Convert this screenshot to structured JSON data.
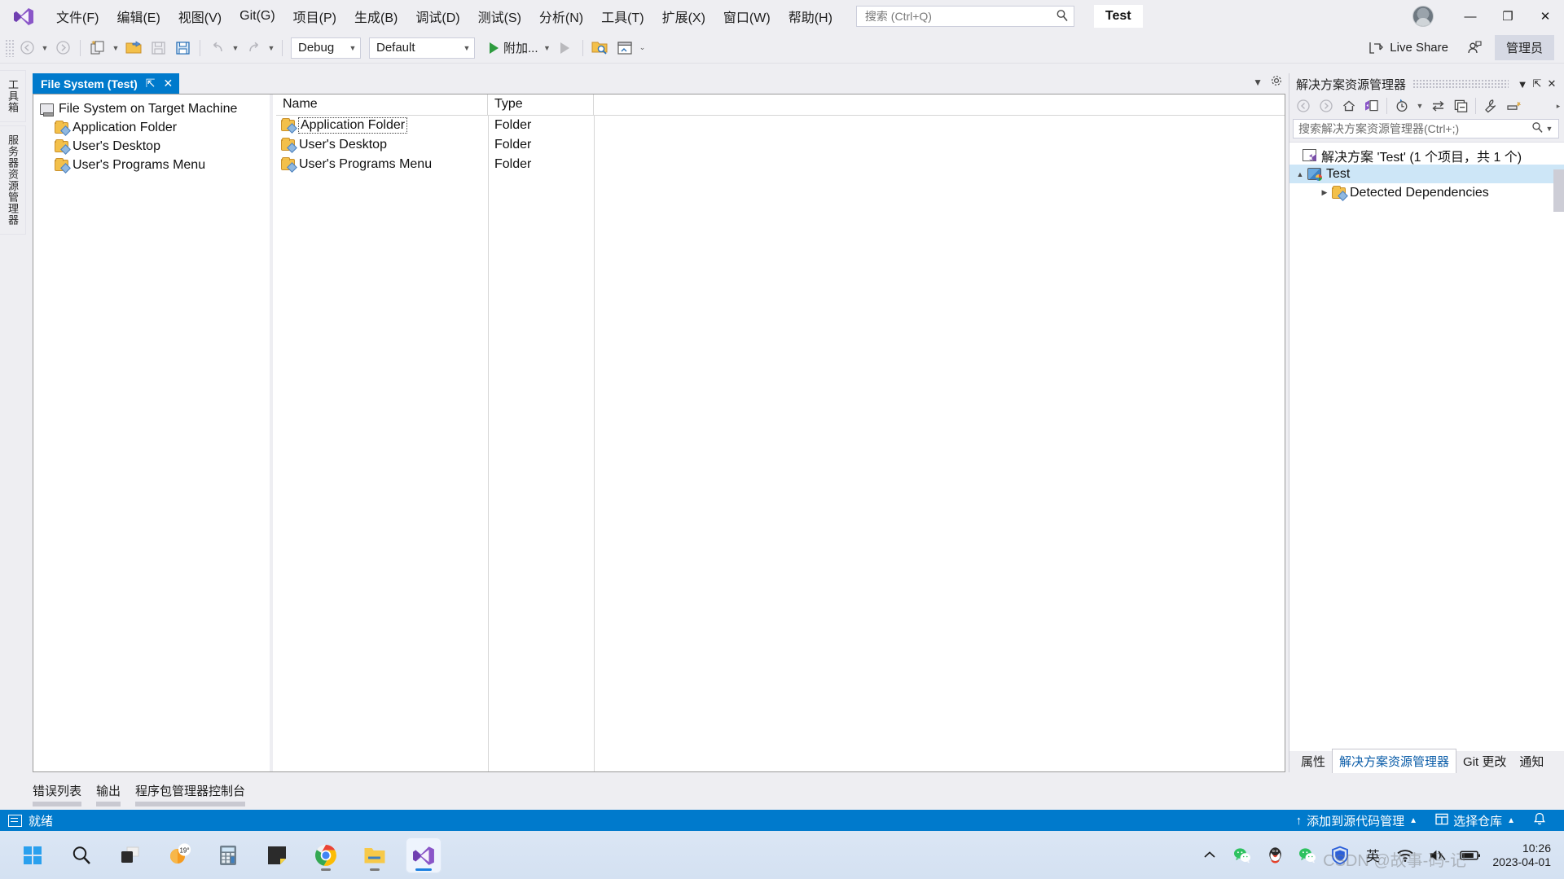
{
  "app": {
    "logo_icon": "visual-studio-logo",
    "solution_badge": "Test",
    "quick_search_placeholder": "搜索 (Ctrl+Q)",
    "search_icon": "search-icon"
  },
  "menu": {
    "items": [
      {
        "label": "文件(F)"
      },
      {
        "label": "编辑(E)"
      },
      {
        "label": "视图(V)"
      },
      {
        "label": "Git(G)"
      },
      {
        "label": "项目(P)"
      },
      {
        "label": "生成(B)"
      },
      {
        "label": "调试(D)"
      },
      {
        "label": "测试(S)"
      },
      {
        "label": "分析(N)"
      },
      {
        "label": "工具(T)"
      },
      {
        "label": "扩展(X)"
      },
      {
        "label": "窗口(W)"
      },
      {
        "label": "帮助(H)"
      }
    ]
  },
  "window_controls": {
    "minimize": "—",
    "maximize": "❐",
    "close": "✕",
    "avatar_icon": "user-avatar"
  },
  "toolbar": {
    "back_icon": "back-arrow-icon",
    "forward_icon": "forward-arrow-icon",
    "new_project_icon": "new-project-icon",
    "open_icon": "open-file-icon",
    "save_icon": "save-icon",
    "save_all_icon": "save-all-icon",
    "undo_icon": "undo-icon",
    "redo_icon": "redo-icon",
    "configuration": "Debug",
    "platform": "Default",
    "run_label": "附加...",
    "run_icon": "play-icon",
    "step_icon": "start-without-debug-icon",
    "find_in_files_icon": "find-in-files-icon",
    "window_layout_icon": "window-layout-icon",
    "overflow_icon": "toolbar-overflow-icon",
    "live_share_label": "Live Share",
    "live_share_icon": "live-share-icon",
    "feedback_icon": "feedback-icon",
    "admin_label": "管理员"
  },
  "left_vertical_tabs": [
    {
      "label": "工具箱"
    },
    {
      "label": "服务器资源管理器"
    }
  ],
  "document": {
    "tab_label": "File System (Test)",
    "pin_icon": "pin-icon",
    "close_icon": "close-icon",
    "dropdown_icon": "chevron-down-icon",
    "settings_icon": "gear-icon"
  },
  "file_system_tree": {
    "root": {
      "label": "File System on Target Machine",
      "icon": "target-machine-icon"
    },
    "children": [
      {
        "label": "Application Folder",
        "icon": "folder-icon"
      },
      {
        "label": "User's Desktop",
        "icon": "folder-icon"
      },
      {
        "label": "User's Programs Menu",
        "icon": "folder-icon"
      }
    ]
  },
  "file_list": {
    "columns": [
      "Name",
      "Type"
    ],
    "rows": [
      {
        "name": "Application Folder",
        "type": "Folder",
        "icon": "folder-icon",
        "selected": true
      },
      {
        "name": "User's Desktop",
        "type": "Folder",
        "icon": "folder-icon",
        "selected": false
      },
      {
        "name": "User's Programs Menu",
        "type": "Folder",
        "icon": "folder-icon",
        "selected": false
      }
    ]
  },
  "bottom_tool_tabs": [
    {
      "label": "错误列表"
    },
    {
      "label": "输出"
    },
    {
      "label": "程序包管理器控制台"
    }
  ],
  "solution_explorer": {
    "title": "解决方案资源管理器",
    "dropdown_icon": "chevron-down-icon",
    "pin_icon": "pin-icon",
    "close_icon": "close-icon",
    "toolbar_icons": [
      "back-arrow-icon",
      "forward-arrow-icon",
      "home-icon",
      "sync-with-active-document-icon",
      "pending-changes-icon",
      "refresh-icon",
      "collapse-all-icon",
      "properties-icon",
      "show-all-files-icon",
      "overflow-icon"
    ],
    "search_placeholder": "搜索解决方案资源管理器(Ctrl+;)",
    "search_icon": "search-icon",
    "tree": [
      {
        "label": "解决方案 'Test' (1 个项目，共 1 个)",
        "icon": "solution-icon",
        "level": 0,
        "selected": false,
        "arrow": ""
      },
      {
        "label": "Test",
        "icon": "project-icon",
        "level": 0,
        "selected": true,
        "arrow": "▲"
      },
      {
        "label": "Detected Dependencies",
        "icon": "folder-icon",
        "level": 1,
        "selected": false,
        "arrow": "▶"
      }
    ],
    "bottom_tabs": [
      {
        "label": "属性",
        "active": false
      },
      {
        "label": "解决方案资源管理器",
        "active": true
      },
      {
        "label": "Git 更改",
        "active": false
      },
      {
        "label": "通知",
        "active": false
      }
    ]
  },
  "status_bar": {
    "state": "就绪",
    "state_icon": "ready-icon",
    "source_control_label": "添加到源代码管理",
    "source_control_icon": "upload-arrow-icon",
    "repo_label": "选择仓库",
    "repo_icon": "repository-icon",
    "notifications_icon": "bell-icon",
    "caret_icon": "chevron-up-icon"
  },
  "taskbar": {
    "items": [
      {
        "name": "start-button",
        "icon": "windows-logo-icon"
      },
      {
        "name": "search-button",
        "icon": "search-icon"
      },
      {
        "name": "task-view-button",
        "icon": "task-view-icon"
      },
      {
        "name": "weather-widget",
        "icon": "weather-icon",
        "label": "19°"
      },
      {
        "name": "calculator-app",
        "icon": "calculator-icon"
      },
      {
        "name": "sticky-notes-app",
        "icon": "sticky-notes-icon"
      },
      {
        "name": "chrome-app",
        "icon": "chrome-icon",
        "running": true
      },
      {
        "name": "file-explorer-app",
        "icon": "folder-icon",
        "running": true
      },
      {
        "name": "visual-studio-app",
        "icon": "visual-studio-logo",
        "running": true,
        "active": true
      }
    ],
    "tray": [
      {
        "name": "tray-overflow",
        "icon": "chevron-up-icon"
      },
      {
        "name": "wechat-tray",
        "icon": "wechat-icon"
      },
      {
        "name": "qq-tray",
        "icon": "qq-icon"
      },
      {
        "name": "wechat-work-tray",
        "icon": "wechat-icon"
      },
      {
        "name": "tencent-security-tray",
        "icon": "shield-icon"
      },
      {
        "name": "ime-indicator",
        "icon": "ime-icon",
        "label": "英"
      },
      {
        "name": "network-icon",
        "icon": "wifi-icon"
      },
      {
        "name": "volume-icon",
        "icon": "volume-muted-icon"
      },
      {
        "name": "battery-icon",
        "icon": "battery-icon"
      }
    ],
    "clock": {
      "time": "10:26",
      "date": "2023-04-01"
    },
    "watermark": "CSDN @故事-码-记"
  },
  "colors": {
    "accent": "#007acc",
    "titlebar": "#eeeef2",
    "selection": "#cde6f7",
    "link": "#0a5ca8"
  }
}
